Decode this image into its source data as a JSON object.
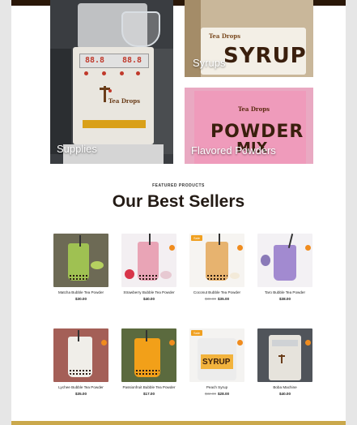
{
  "categories": [
    {
      "label": "Supplies"
    },
    {
      "label": "Syrups"
    },
    {
      "label": "Flavored Powders"
    }
  ],
  "category_images": {
    "machine_display_left": "88.8",
    "machine_display_right": "88.8",
    "machine_brand": "Tea Drops",
    "syrup_brand": "Tea Drops",
    "syrup_word": "SYRUP",
    "powder_brand": "Tea Drops",
    "powder_word": "POWDER",
    "powder_word2": "MIX"
  },
  "featured": {
    "eyebrow": "FEATURED PRODUCTS",
    "title": "Our Best Sellers"
  },
  "products": [
    {
      "name": "Matcha Bubble Tea Powder",
      "price": "$30.00",
      "old_price": "",
      "badge": "",
      "cart_icon": false
    },
    {
      "name": "Strawberry Bubble Tea Powder",
      "price": "$40.00",
      "old_price": "",
      "badge": "",
      "cart_icon": true
    },
    {
      "name": "Coconut Bubble Tea Powder",
      "price": "$35.00",
      "old_price": "$38.00",
      "badge": "Sale",
      "cart_icon": true
    },
    {
      "name": "Taro Bubble Tea Powder",
      "price": "$38.00",
      "old_price": "",
      "badge": "",
      "cart_icon": true
    },
    {
      "name": "Lychee Bubble Tea Powder",
      "price": "$35.00",
      "old_price": "",
      "badge": "",
      "cart_icon": true
    },
    {
      "name": "Passionfruit Bubble Tea Powder",
      "price": "$17.00",
      "old_price": "",
      "badge": "",
      "cart_icon": true
    },
    {
      "name": "Peach Syrup",
      "price": "$28.00",
      "old_price": "$32.00",
      "badge": "Sale",
      "cart_icon": true
    },
    {
      "name": "Boba Machine",
      "price": "$40.00",
      "old_price": "",
      "badge": "",
      "cart_icon": true
    }
  ],
  "product_images": {
    "peach_syrup_label": "SYRUP"
  },
  "colors": {
    "topbar": "#2a1708",
    "accent_orange": "#f08c1e",
    "heading": "#231a14",
    "bottom_bar": "#caa84c"
  }
}
